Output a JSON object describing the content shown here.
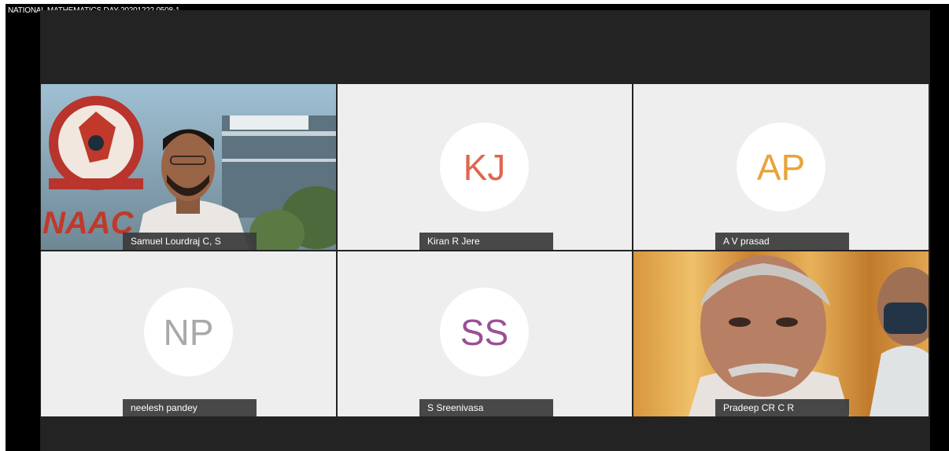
{
  "recording_title": "NATIONAL MATHEMATICS DAY-20201222 0508-1",
  "participants": [
    {
      "name": "Samuel Lourdraj C, S",
      "initials": "",
      "type": "video"
    },
    {
      "name": "Kiran R Jere",
      "initials": "KJ",
      "type": "avatar",
      "color": "#e0664f"
    },
    {
      "name": "A V prasad",
      "initials": "AP",
      "type": "avatar",
      "color": "#e8a33c"
    },
    {
      "name": "neelesh pandey",
      "initials": "NP",
      "type": "avatar",
      "color": "#a9a9a9"
    },
    {
      "name": "S Sreenivasa",
      "initials": "SS",
      "type": "avatar",
      "color": "#9b4f96"
    },
    {
      "name": "Pradeep CR C R",
      "initials": "",
      "type": "video"
    }
  ],
  "video_overlay_text": {
    "naac_logo": "NAAC",
    "naac_seal": "NAAC"
  }
}
